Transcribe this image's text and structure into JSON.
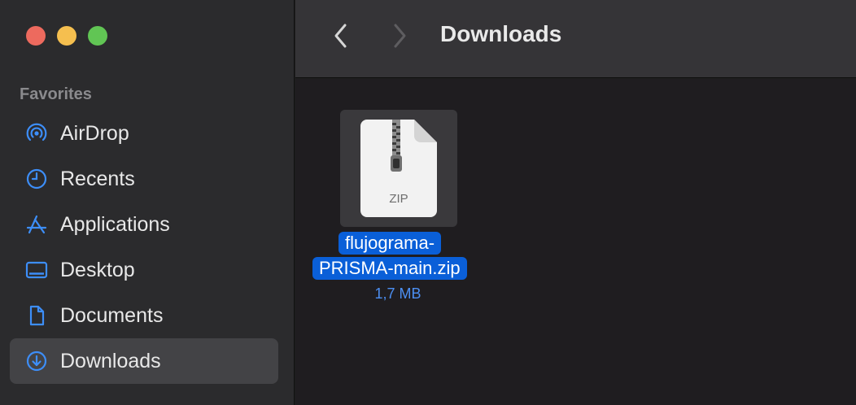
{
  "window": {
    "title": "Downloads"
  },
  "sidebar": {
    "section_header": "Favorites",
    "items": [
      {
        "label": "AirDrop",
        "icon": "airdrop-icon"
      },
      {
        "label": "Recents",
        "icon": "clock-icon"
      },
      {
        "label": "Applications",
        "icon": "applications-icon"
      },
      {
        "label": "Desktop",
        "icon": "desktop-icon"
      },
      {
        "label": "Documents",
        "icon": "document-icon"
      },
      {
        "label": "Downloads",
        "icon": "download-icon",
        "selected": true
      }
    ]
  },
  "files": [
    {
      "name_line1": "flujograma-",
      "name_line2": "PRISMA-main.zip",
      "size": "1,7 MB",
      "thumb_label": "ZIP",
      "icon": "zip-file-icon",
      "selected": true
    }
  ],
  "colors": {
    "accent": "#0a5fd8",
    "sidebar_icon": "#3d8ef8",
    "close": "#ed6a5e",
    "minimize": "#f5bf4f",
    "maximize": "#61c554"
  }
}
